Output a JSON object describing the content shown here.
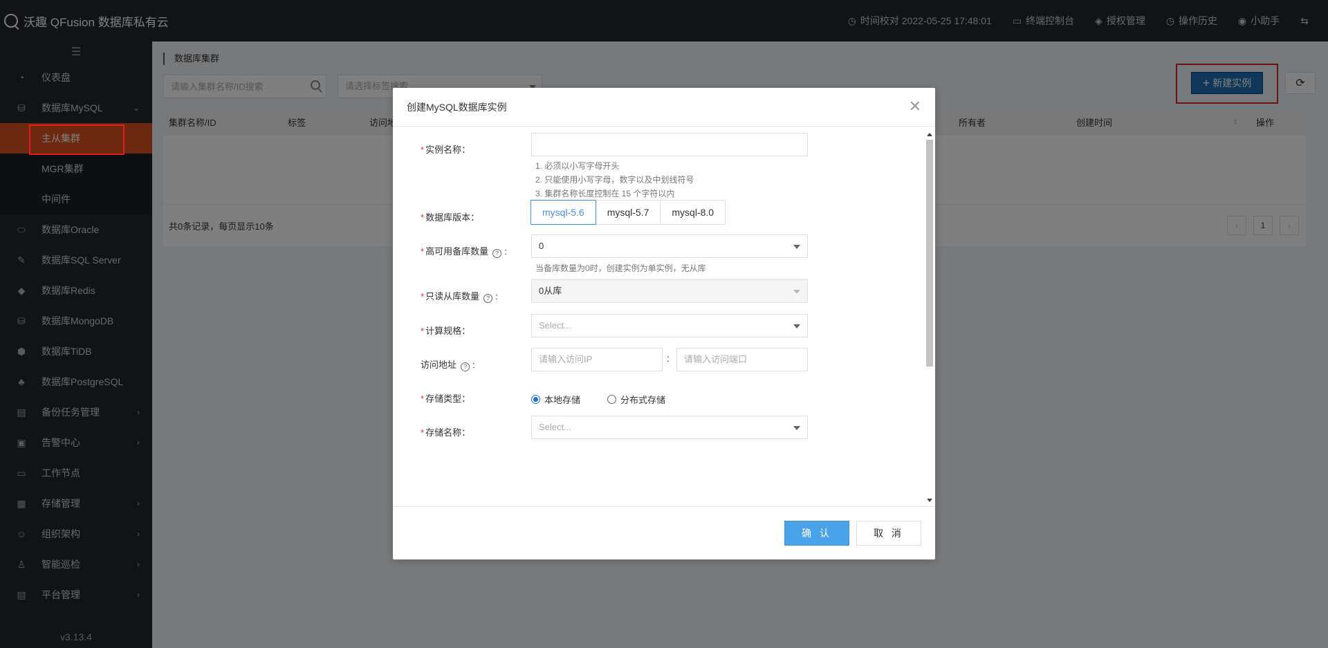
{
  "app": {
    "title": "沃趣 QFusion 数据库私有云"
  },
  "topnav": {
    "time_sync": "时间校对 2022-05-25 17:48:01",
    "terminal": "终端控制台",
    "license": "授权管理",
    "history": "操作历史",
    "assistant": "小助手"
  },
  "sidebar": {
    "collapse_icon": "menu-icon",
    "items": [
      {
        "label": "仪表盘",
        "icon": "dashboard-icon"
      },
      {
        "label": "数据库MySQL",
        "icon": "mysql-icon"
      },
      {
        "label": "数据库Oracle",
        "icon": "oracle-icon"
      },
      {
        "label": "数据库SQL Server",
        "icon": "sqlserver-icon"
      },
      {
        "label": "数据库Redis",
        "icon": "redis-icon"
      },
      {
        "label": "数据库MongoDB",
        "icon": "mongodb-icon"
      },
      {
        "label": "数据库TiDB",
        "icon": "tidb-icon"
      },
      {
        "label": "数据库PostgreSQL",
        "icon": "postgresql-icon"
      },
      {
        "label": "备份任务管理",
        "icon": "backup-icon"
      },
      {
        "label": "告警中心",
        "icon": "alert-icon"
      },
      {
        "label": "工作节点",
        "icon": "node-icon"
      },
      {
        "label": "存储管理",
        "icon": "storage-icon"
      },
      {
        "label": "组织架构",
        "icon": "org-icon"
      },
      {
        "label": "智能巡检",
        "icon": "inspect-icon"
      },
      {
        "label": "平台管理",
        "icon": "platform-icon"
      }
    ],
    "sub_items": [
      "主从集群",
      "MGR集群",
      "中间件"
    ],
    "version": "v3.13.4"
  },
  "main": {
    "breadcrumb": "数据库集群",
    "search_placeholder": "请输入集群名称/ID搜索",
    "tag_placeholder": "请选择标签搜索",
    "new_button": "新建实例",
    "columns": [
      "集群名称/ID",
      "标签",
      "访问地",
      "所有者",
      "创建时间",
      "操作"
    ],
    "summary": "共0条记录，每页显示10条",
    "page": "1"
  },
  "modal": {
    "title": "创建MySQL数据库实例",
    "fields": {
      "name_label": "实例名称：",
      "name_value": "",
      "name_hints": [
        "1. 必须以小写字母开头",
        "2. 只能使用小写字母，数字以及中划线符号",
        "3. 集群名称长度控制在 15 个字符以内"
      ],
      "version_label": "数据库版本：",
      "versions": [
        "mysql-5.6",
        "mysql-5.7",
        "mysql-8.0"
      ],
      "selected_version": "mysql-5.6",
      "ha_label": "高可用备库数量",
      "ha_value": "0",
      "ha_hint": "当备库数量为0时，创建实例为单实例，无从库",
      "ro_label": "只读从库数量",
      "ro_value": "0从库",
      "spec_label": "计算规格：",
      "spec_placeholder": "Select...",
      "addr_label": "访问地址",
      "ip_placeholder": "请输入访问IP",
      "port_placeholder": "请输入访问端口",
      "addr_sep": ":",
      "storage_type_label": "存储类型：",
      "storage_local": "本地存储",
      "storage_dist": "分布式存储",
      "storage_name_label": "存储名称：",
      "storage_name_placeholder": "Select..."
    },
    "confirm": "确 认",
    "cancel": "取 消"
  }
}
